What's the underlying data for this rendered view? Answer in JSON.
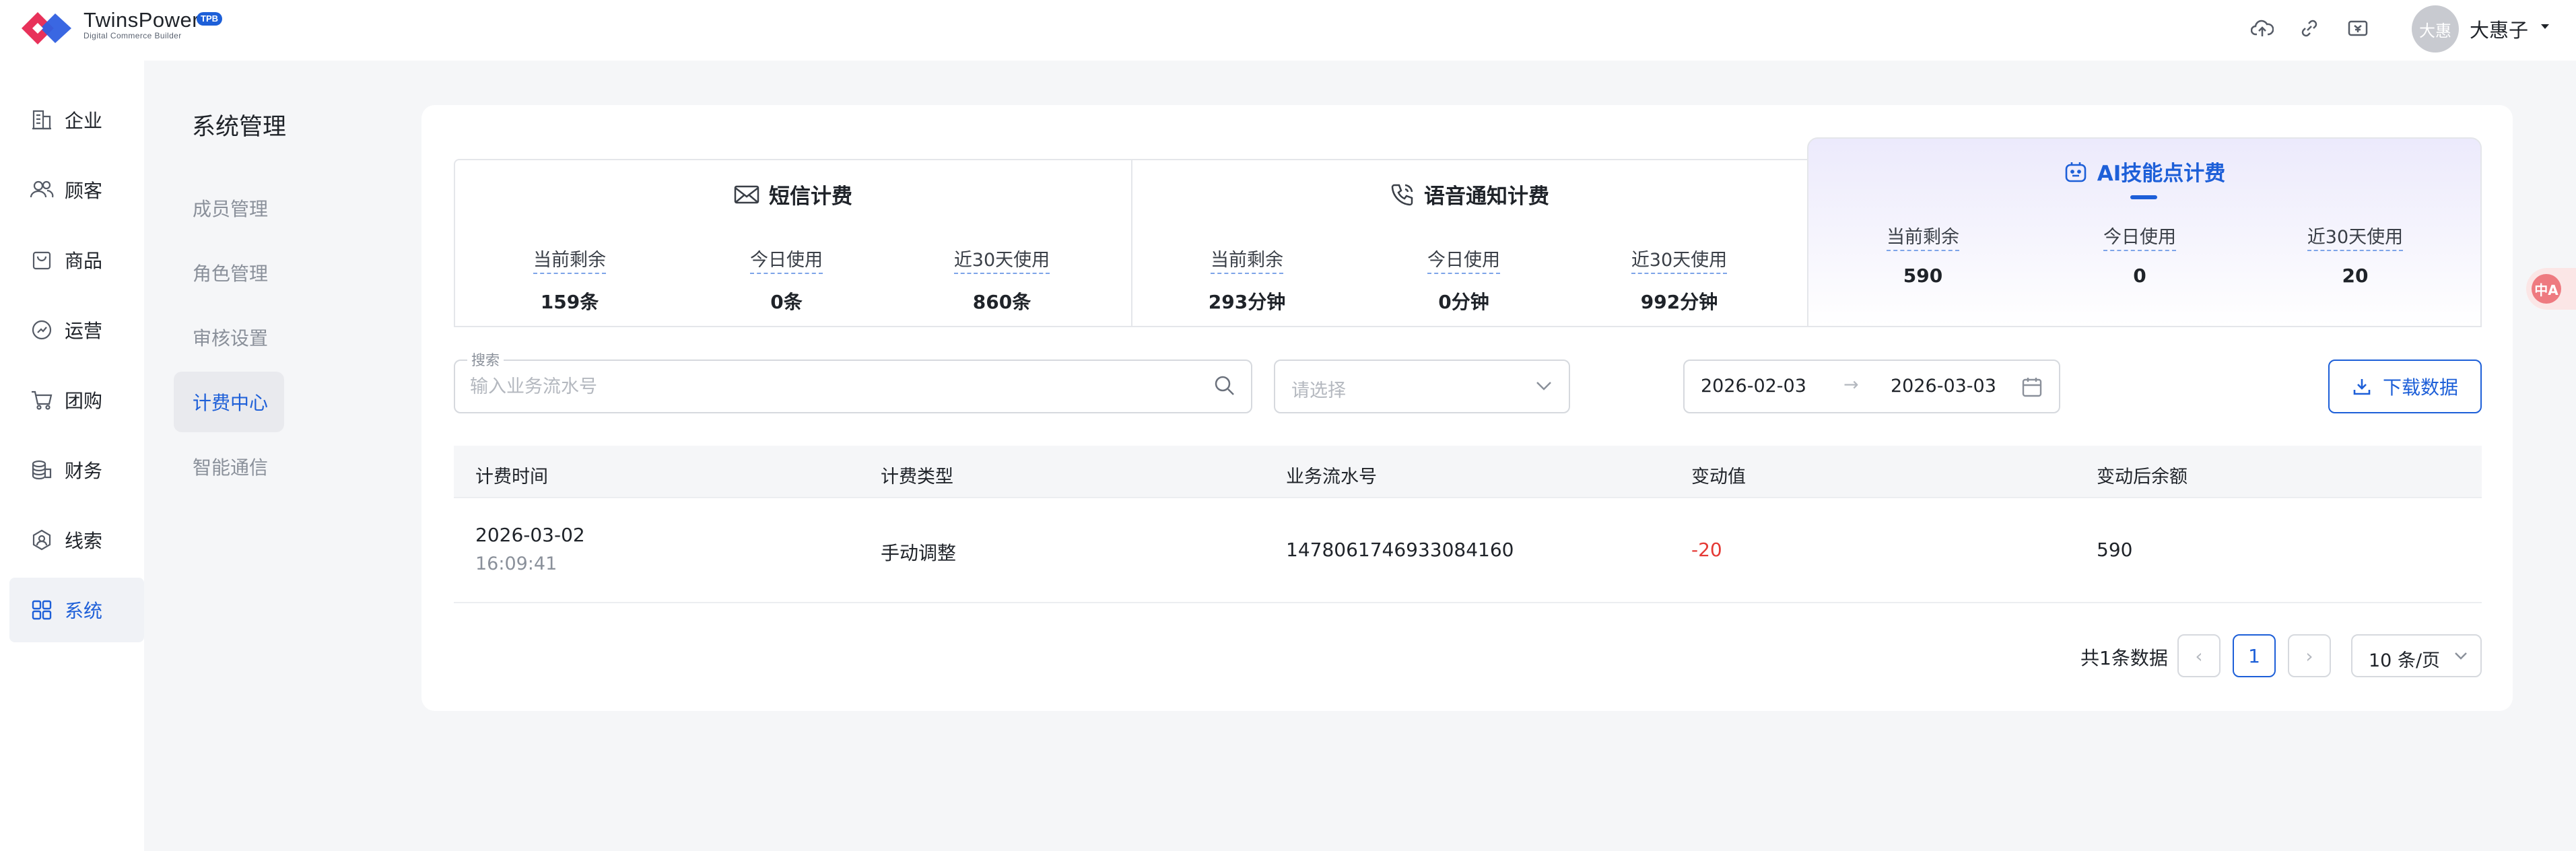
{
  "brand": {
    "name": "TwinsPower",
    "badge": "TPB",
    "subtitle": "Digital Commerce Builder"
  },
  "header": {
    "icons": [
      "cloud-upload-icon",
      "link-icon",
      "invoice-icon"
    ],
    "avatar_text": "大惠",
    "user_name": "大惠子"
  },
  "nav": {
    "items": [
      {
        "label": "企业",
        "icon": "building-icon"
      },
      {
        "label": "顾客",
        "icon": "users-icon"
      },
      {
        "label": "商品",
        "icon": "bag-icon"
      },
      {
        "label": "运营",
        "icon": "operation-icon"
      },
      {
        "label": "团购",
        "icon": "cart-icon"
      },
      {
        "label": "财务",
        "icon": "coins-icon"
      },
      {
        "label": "线索",
        "icon": "leads-icon"
      },
      {
        "label": "系统",
        "icon": "grid-icon",
        "active": true
      }
    ]
  },
  "submenu": {
    "title": "系统管理",
    "items": [
      {
        "label": "成员管理"
      },
      {
        "label": "角色管理"
      },
      {
        "label": "审核设置"
      },
      {
        "label": "计费中心",
        "active": true
      },
      {
        "label": "智能通信"
      }
    ]
  },
  "stats": {
    "sms": {
      "title": "短信计费",
      "icon": "mail-icon",
      "items": [
        {
          "label": "当前剩余",
          "value": "159条"
        },
        {
          "label": "今日使用",
          "value": "0条"
        },
        {
          "label": "近30天使用",
          "value": "860条"
        }
      ]
    },
    "voice": {
      "title": "语音通知计费",
      "icon": "phone-icon",
      "items": [
        {
          "label": "当前剩余",
          "value": "293分钟"
        },
        {
          "label": "今日使用",
          "value": "0分钟"
        },
        {
          "label": "近30天使用",
          "value": "992分钟"
        }
      ]
    },
    "ai": {
      "title": "AI技能点计费",
      "icon": "robot-icon",
      "items": [
        {
          "label": "当前剩余",
          "value": "590"
        },
        {
          "label": "今日使用",
          "value": "0"
        },
        {
          "label": "近30天使用",
          "value": "20"
        }
      ]
    }
  },
  "filters": {
    "search_legend": "搜索",
    "search_placeholder": "输入业务流水号",
    "select_placeholder": "请选择",
    "date_start": "2026-02-03",
    "date_arrow": "→",
    "date_end": "2026-03-03",
    "download_label": "下载数据"
  },
  "table": {
    "columns": [
      "计费时间",
      "计费类型",
      "业务流水号",
      "变动值",
      "变动后余额"
    ],
    "rows": [
      {
        "date": "2026-03-02",
        "time": "16:09:41",
        "type": "手动调整",
        "serial": "1478061746933084160",
        "change": "-20",
        "balance": "590"
      }
    ]
  },
  "pagination": {
    "total_text": "共1条数据",
    "prev": "‹",
    "current": "1",
    "next": "›",
    "page_size": "10 条/页"
  },
  "float_button": {
    "label": "中A"
  },
  "colors": {
    "accent": "#1d5fd8",
    "negative": "#e53935"
  }
}
